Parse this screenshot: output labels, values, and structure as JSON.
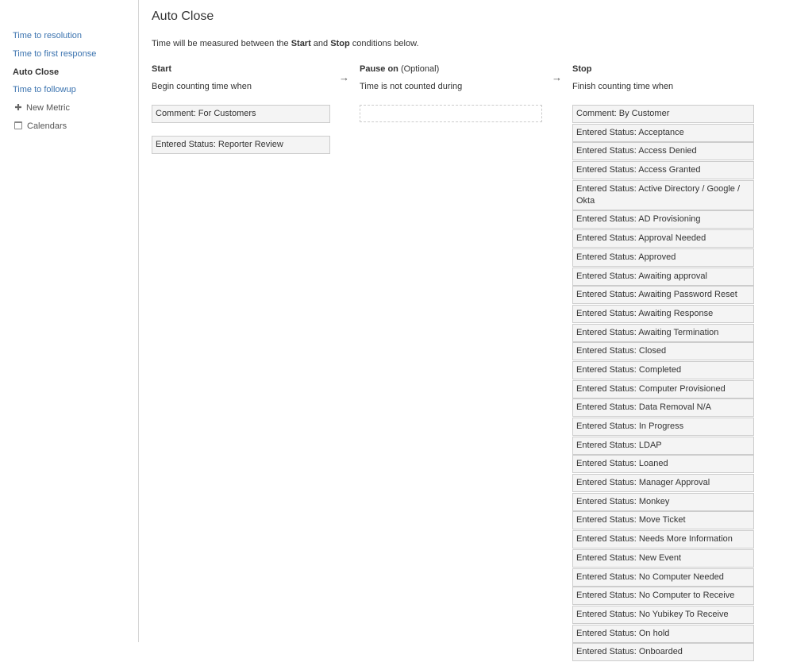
{
  "sidebar": {
    "items": [
      {
        "label": "Time to resolution"
      },
      {
        "label": "Time to first response"
      },
      {
        "label": "Auto Close"
      },
      {
        "label": "Time to followup"
      },
      {
        "label": "New Metric"
      },
      {
        "label": "Calendars"
      }
    ]
  },
  "page": {
    "title": "Auto Close",
    "intro_before": "Time will be measured between the ",
    "intro_start": "Start",
    "intro_and": " and ",
    "intro_stop": "Stop",
    "intro_after": " conditions below."
  },
  "start": {
    "heading": "Start",
    "sub": "Begin counting time when",
    "conditions": [
      "Comment: For Customers",
      "Entered Status: Reporter Review"
    ]
  },
  "pause": {
    "heading": "Pause on",
    "optional": " (Optional)",
    "sub": "Time is not counted during"
  },
  "stop": {
    "heading": "Stop",
    "sub": "Finish counting time when",
    "conditions": [
      "Comment: By Customer",
      "Entered Status: Acceptance",
      "Entered Status: Access Denied",
      "Entered Status: Access Granted",
      "Entered Status: Active Directory / Google / Okta",
      "Entered Status: AD Provisioning",
      "Entered Status: Approval Needed",
      "Entered Status: Approved",
      "Entered Status: Awaiting approval",
      "Entered Status: Awaiting Password Reset",
      "Entered Status: Awaiting Response",
      "Entered Status: Awaiting Termination",
      "Entered Status: Closed",
      "Entered Status: Completed",
      "Entered Status: Computer Provisioned",
      "Entered Status: Data Removal N/A",
      "Entered Status: In Progress",
      "Entered Status: LDAP",
      "Entered Status: Loaned",
      "Entered Status: Manager Approval",
      "Entered Status: Monkey",
      "Entered Status: Move Ticket",
      "Entered Status: Needs More Information",
      "Entered Status: New Event",
      "Entered Status: No Computer Needed",
      "Entered Status: No Computer to Receive",
      "Entered Status: No Yubikey To Receive",
      "Entered Status: On hold",
      "Entered Status: Onboarded"
    ]
  },
  "arrows": {
    "symbol": "→"
  }
}
